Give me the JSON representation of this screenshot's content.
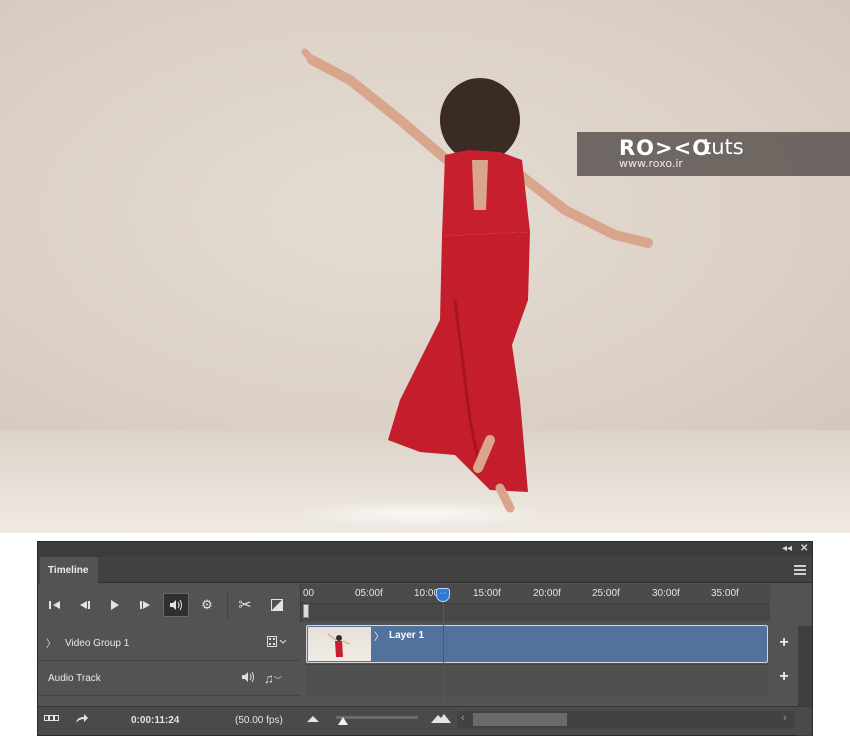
{
  "watermark": {
    "logo": "RO><O",
    "suffix": "tuts",
    "url": "www.roxo.ir"
  },
  "panel": {
    "collapse_icon": "double-chevron-left-icon",
    "close_icon": "close-icon",
    "tab_label": "Timeline",
    "menu_icon": "panel-menu-icon"
  },
  "controls": [
    {
      "name": "go-to-first-frame-button",
      "icon": "first-frame-icon"
    },
    {
      "name": "previous-frame-button",
      "icon": "previous-frame-icon"
    },
    {
      "name": "play-button",
      "icon": "play-icon"
    },
    {
      "name": "next-frame-button",
      "icon": "next-frame-icon"
    },
    {
      "name": "mute-audio-button",
      "icon": "speaker-icon",
      "active": true
    },
    {
      "name": "playback-settings-button",
      "icon": "gear-icon"
    },
    {
      "name": "split-at-playhead-button",
      "icon": "scissors-icon"
    },
    {
      "name": "transition-button",
      "icon": "transition-icon"
    }
  ],
  "ruler": {
    "ticks": [
      "00",
      "05:00f",
      "10:00f",
      "15:00f",
      "20:00f",
      "25:00f",
      "30:00f",
      "35:00f"
    ]
  },
  "tracks": {
    "video_group": {
      "label": "Video Group 1",
      "icon": "film-strip-icon"
    },
    "audio_track": {
      "label": "Audio Track",
      "icon": "speaker-icon",
      "note_icon": "music-note-icon"
    }
  },
  "clip": {
    "name": "Layer 1",
    "color": "#52729e"
  },
  "playhead": {
    "color": "#e02020"
  },
  "footer": {
    "render_icon": "render-video-icon",
    "convert_icon": "convert-arrow-icon",
    "current_time": "0:00:11:24",
    "frame_rate": "(50.00 fps)",
    "zoom_out_icon": "small-mountain-icon",
    "zoom_in_icon": "large-mountain-icon"
  }
}
